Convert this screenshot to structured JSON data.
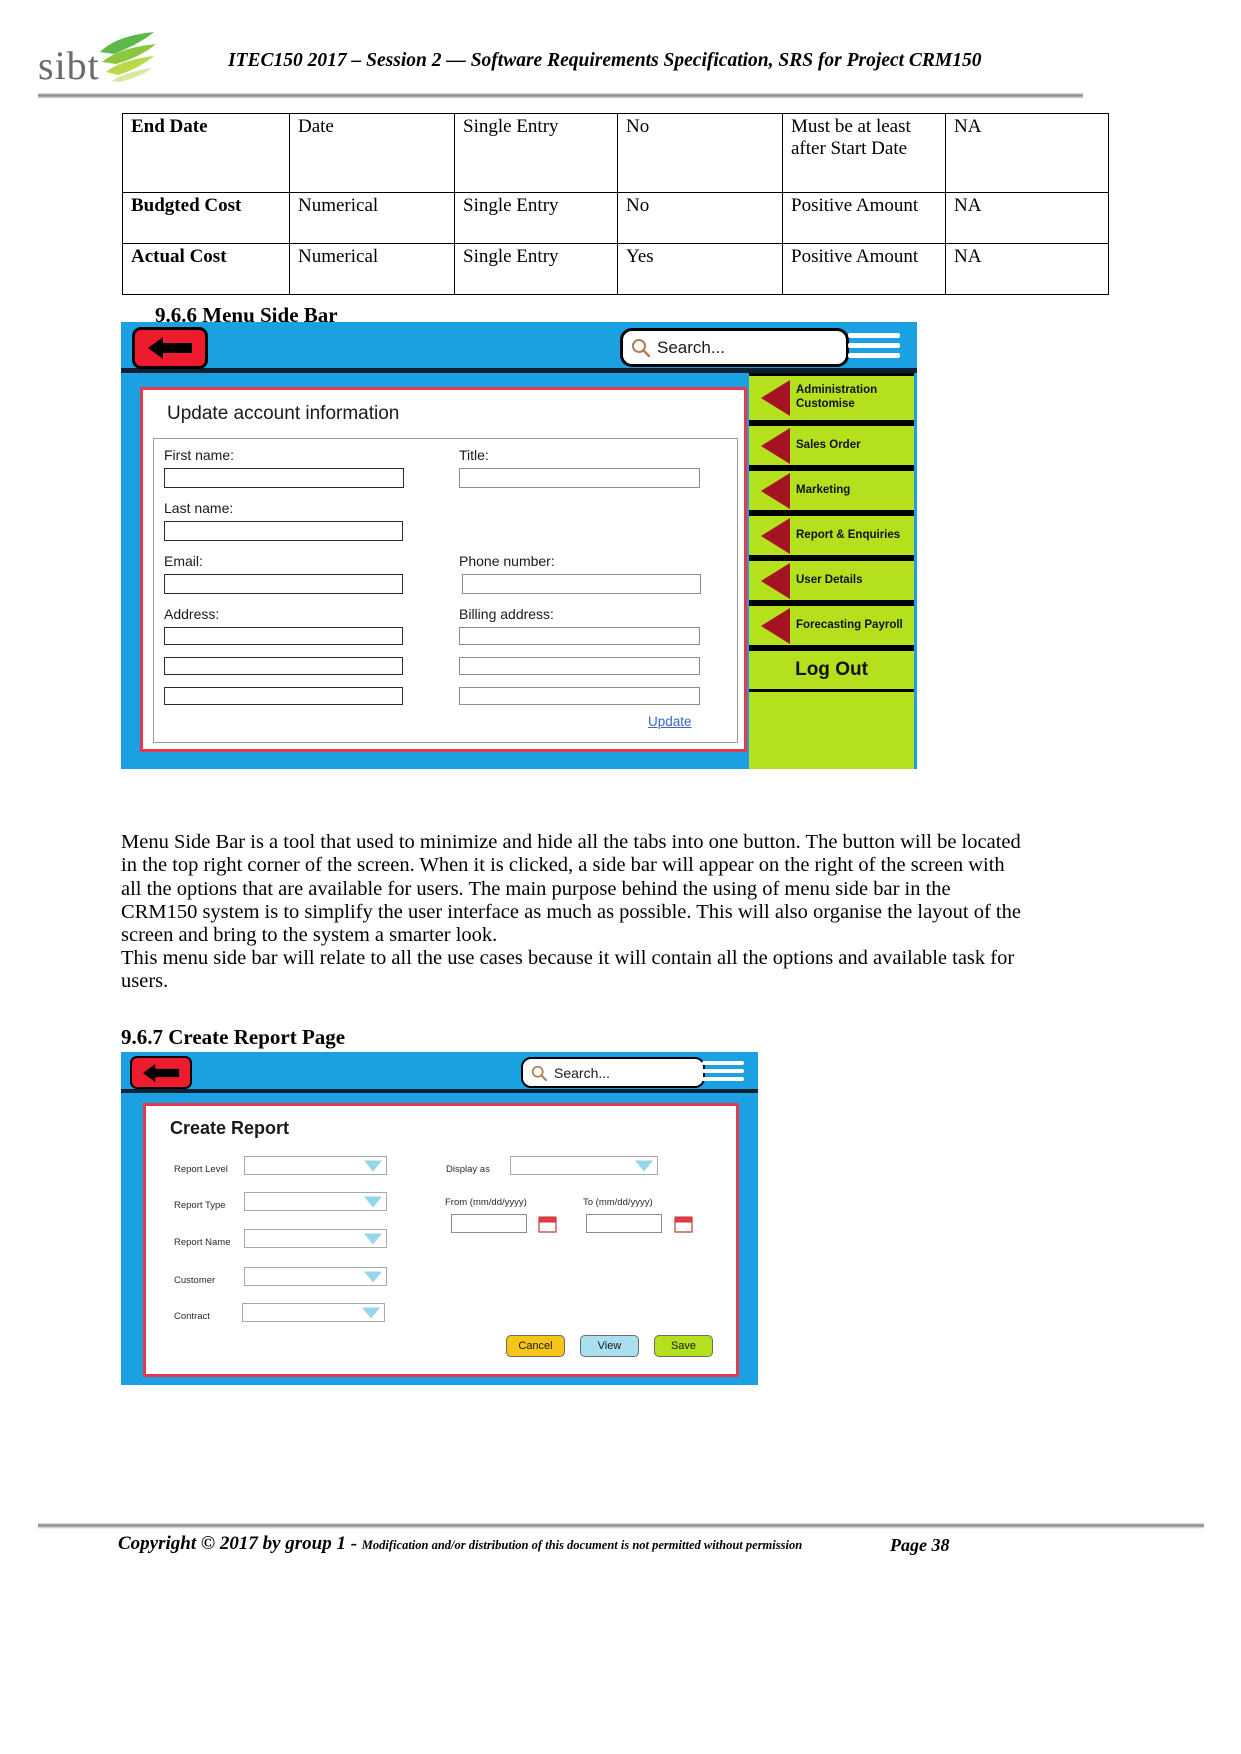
{
  "header": {
    "logo_text": "sibt",
    "title": "ITEC150 2017 – Session 2 — Software Requirements Specification, SRS for Project CRM150"
  },
  "spec_table": {
    "rows": [
      {
        "name": "End Date",
        "type": "Date",
        "entry": "Single Entry",
        "required": "No",
        "validation": "Must be at least after Start Date",
        "notes": "NA"
      },
      {
        "name": "Budgted Cost",
        "type": "Numerical",
        "entry": "Single Entry",
        "required": "No",
        "validation": "Positive Amount",
        "notes": "NA"
      },
      {
        "name": "Actual Cost",
        "type": "Numerical",
        "entry": "Single Entry",
        "required": "Yes",
        "validation": "Positive Amount",
        "notes": "NA"
      }
    ]
  },
  "section_966": {
    "heading": "9.6.6  Menu Side Bar",
    "mockup": {
      "search_placeholder": "Search...",
      "back_icon": "back-arrow-icon",
      "menu_icon": "hamburger-menu-icon",
      "panel_title": "Update account information",
      "fields": {
        "first_name": "First name:",
        "last_name": "Last name:",
        "email": "Email:",
        "address": "Address:",
        "title": "Title:",
        "phone": "Phone number:",
        "billing_address": "Billing address:"
      },
      "update_link": "Update",
      "sidebar": {
        "items": [
          {
            "label_line1": "Administration",
            "label_line2": "Customise"
          },
          {
            "label_line1": "Sales Order",
            "label_line2": ""
          },
          {
            "label_line1": "Marketing",
            "label_line2": ""
          },
          {
            "label_line1": "Report & Enquiries",
            "label_line2": ""
          },
          {
            "label_line1": "User Details",
            "label_line2": ""
          },
          {
            "label_line1": "Forecasting Payroll",
            "label_line2": ""
          }
        ],
        "logout": "Log Out"
      }
    },
    "paragraph1": "Menu Side Bar is a tool that used to minimize and hide all the tabs into one button. The button will be located in the top right corner of the screen. When it is clicked, a side bar will appear on the right of the screen with all the options that are available for users. The main purpose behind the using of menu side bar in the CRM150 system is to simplify the user interface as much as possible. This will also organise the layout of the screen and bring to the system a smarter look.",
    "paragraph2": "This menu side bar will relate to all the use cases because it will contain all the options and available task for users."
  },
  "section_967": {
    "heading": "9.6.7 Create Report Page",
    "mockup": {
      "search_placeholder": "Search...",
      "back_icon": "back-arrow-icon",
      "menu_icon": "hamburger-menu-icon",
      "panel_title": "Create Report",
      "left_fields": [
        {
          "label": "Report Level",
          "value": ""
        },
        {
          "label": "Report Type",
          "value": ""
        },
        {
          "label": "Report Name",
          "value": ""
        },
        {
          "label": "Customer",
          "value": ""
        },
        {
          "label": "Contract",
          "value": ""
        }
      ],
      "right_fields": {
        "display_as": "Display as",
        "display_as_value": "",
        "from_label": "From (mm/dd/yyyy)",
        "from_value": "",
        "to_label": "To (mm/dd/yyyy)",
        "to_value": ""
      },
      "buttons": {
        "cancel": "Cancel",
        "view": "View",
        "save": "Save"
      }
    }
  },
  "footer": {
    "copyright": "Copyright © 2017 by group 1 - ",
    "note": "Modification and/or distribution of this document is not permitted without permission",
    "page": "Page 38"
  },
  "colors": {
    "mock_blue": "#1ba1e2",
    "sidebar_green": "#b5e01e",
    "accent_red": "#e8384f",
    "triangle_dark_red": "#a31322",
    "back_button_red": "#ee1b2e"
  }
}
